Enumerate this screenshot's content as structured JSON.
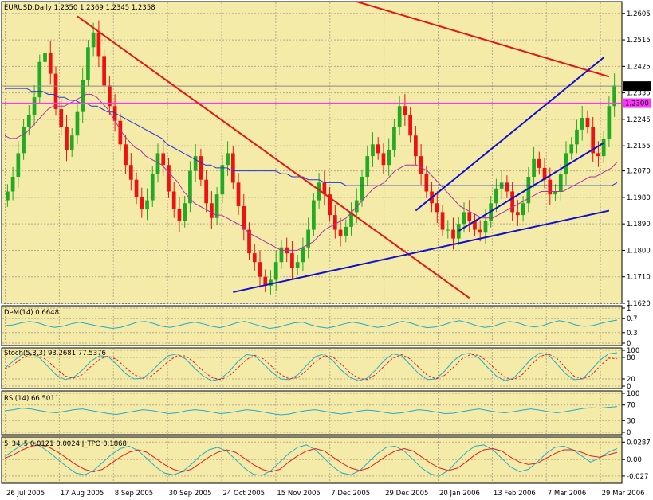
{
  "colors": {
    "background": "#F5EBA8",
    "grid": "#B5A98A",
    "bull": "#22AA22",
    "bear": "#EE1111",
    "trend_red": "#E01818",
    "trend_blue": "#1010CC",
    "ma_long": "#2233DD",
    "ma_short": "#AA33AA",
    "level_magenta": "#FF33FF",
    "indicator_teal": "#22AACC",
    "signal_red": "#DD2222"
  },
  "chart_data": [
    {
      "type": "candlestick",
      "title": "EURUSD,Daily  1.2350 1.2369 1.2345 1.2358",
      "ylim": [
        1.162,
        1.2645
      ],
      "yticks": [
        "1.2605",
        "1.2515",
        "1.2425",
        "1.2335",
        "1.2245",
        "1.2155",
        "1.2070",
        "1.1980",
        "1.1890",
        "1.1800",
        "1.1710",
        "1.1620"
      ],
      "price_label": "1.2358",
      "level_label": "1.2300",
      "xticks": [
        "26 Jul 2005",
        "17 Aug 2005",
        "8 Sep 2005",
        "30 Sep 2005",
        "24 Oct 2005",
        "15 Nov 2005",
        "7 Dec 2005",
        "29 Dec 2005",
        "20 Jan 2006",
        "13 Feb 2006",
        "7 Mar 2006",
        "29 Mar 2006"
      ],
      "close": [
        1.2,
        1.205,
        1.213,
        1.222,
        1.226,
        1.232,
        1.244,
        1.247,
        1.24,
        1.228,
        1.222,
        1.214,
        1.219,
        1.227,
        1.238,
        1.249,
        1.254,
        1.246,
        1.236,
        1.229,
        1.224,
        1.216,
        1.209,
        1.204,
        1.198,
        1.194,
        1.197,
        1.206,
        1.213,
        1.209,
        1.2,
        1.194,
        1.19,
        1.196,
        1.207,
        1.212,
        1.204,
        1.196,
        1.191,
        1.199,
        1.209,
        1.213,
        1.203,
        1.195,
        1.187,
        1.179,
        1.176,
        1.171,
        1.168,
        1.17,
        1.176,
        1.181,
        1.179,
        1.174,
        1.176,
        1.181,
        1.187,
        1.197,
        1.203,
        1.199,
        1.192,
        1.187,
        1.185,
        1.188,
        1.193,
        1.197,
        1.205,
        1.212,
        1.216,
        1.213,
        1.209,
        1.214,
        1.222,
        1.229,
        1.226,
        1.219,
        1.212,
        1.206,
        1.2,
        1.196,
        1.193,
        1.187,
        1.187,
        1.184,
        1.189,
        1.193,
        1.19,
        1.187,
        1.186,
        1.19,
        1.196,
        1.201,
        1.203,
        1.2,
        1.193,
        1.192,
        1.196,
        1.205,
        1.211,
        1.208,
        1.204,
        1.199,
        1.2,
        1.206,
        1.213,
        1.216,
        1.221,
        1.225,
        1.222,
        1.213,
        1.212,
        1.218,
        1.229,
        1.236
      ],
      "ma_long": [
        1.235,
        1.235,
        1.235,
        1.235,
        1.235,
        1.234,
        1.234,
        1.234,
        1.233,
        1.233,
        1.232,
        1.232,
        1.231,
        1.231,
        1.23,
        1.23,
        1.229,
        1.229,
        1.228,
        1.227,
        1.227,
        1.226,
        1.225,
        1.224,
        1.223,
        1.222,
        1.221,
        1.22,
        1.219,
        1.218,
        1.216,
        1.215,
        1.214,
        1.213,
        1.212,
        1.211,
        1.21,
        1.209,
        1.209,
        1.208,
        1.208,
        1.208,
        1.207,
        1.207,
        1.207,
        1.207,
        1.207,
        1.207,
        1.207,
        1.207,
        1.207,
        1.206,
        1.206,
        1.205,
        1.205,
        1.205,
        1.204,
        1.204,
        1.204,
        1.203,
        1.203,
        1.203,
        1.203,
        1.202,
        1.202,
        1.202,
        1.202,
        1.202,
        1.202,
        1.202,
        1.202,
        1.202,
        1.202,
        1.202,
        1.202,
        1.202,
        1.202,
        1.202,
        1.202,
        1.202,
        1.202,
        1.202,
        1.202,
        1.202,
        1.202,
        1.202,
        1.202,
        1.202,
        1.202,
        1.202,
        1.202,
        1.202,
        1.202,
        1.202,
        1.202,
        1.202,
        1.202,
        1.202,
        1.202,
        1.202,
        1.202,
        1.202,
        1.202,
        1.202,
        1.202,
        1.202,
        1.202,
        1.202,
        1.202,
        1.202,
        1.202,
        1.202,
        1.202,
        1.203
      ],
      "ma_short": [
        1.219,
        1.218,
        1.218,
        1.219,
        1.22,
        1.222,
        1.224,
        1.226,
        1.228,
        1.229,
        1.229,
        1.229,
        1.23,
        1.231,
        1.232,
        1.233,
        1.233,
        1.232,
        1.23,
        1.228,
        1.225,
        1.222,
        1.219,
        1.217,
        1.215,
        1.214,
        1.212,
        1.211,
        1.21,
        1.209,
        1.207,
        1.205,
        1.203,
        1.2,
        1.198,
        1.196,
        1.195,
        1.194,
        1.193,
        1.192,
        1.192,
        1.191,
        1.19,
        1.189,
        1.188,
        1.186,
        1.185,
        1.184,
        1.183,
        1.182,
        1.181,
        1.18,
        1.18,
        1.18,
        1.18,
        1.181,
        1.182,
        1.183,
        1.185,
        1.187,
        1.188,
        1.189,
        1.19,
        1.191,
        1.193,
        1.195,
        1.197,
        1.199,
        1.201,
        1.202,
        1.203,
        1.205,
        1.207,
        1.208,
        1.209,
        1.209,
        1.209,
        1.208,
        1.207,
        1.205,
        1.203,
        1.201,
        1.199,
        1.197,
        1.195,
        1.194,
        1.193,
        1.192,
        1.191,
        1.191,
        1.191,
        1.192,
        1.193,
        1.194,
        1.195,
        1.196,
        1.197,
        1.198,
        1.199,
        1.2,
        1.2,
        1.2,
        1.2,
        1.2,
        1.201,
        1.202,
        1.203,
        1.204,
        1.205,
        1.205,
        1.206,
        1.207,
        1.208,
        1.21
      ]
    },
    {
      "type": "line",
      "title": "DeM(14) 0.6648",
      "ylim": [
        0,
        1
      ],
      "yticks": [
        "1",
        "0.7",
        "0.3",
        "0"
      ],
      "series": [
        {
          "values": [
            0.5,
            0.52,
            0.58,
            0.62,
            0.58,
            0.5,
            0.45,
            0.48,
            0.55,
            0.6,
            0.55,
            0.5,
            0.46,
            0.42,
            0.45,
            0.52,
            0.6,
            0.62,
            0.56,
            0.48,
            0.45,
            0.5,
            0.56,
            0.6,
            0.55,
            0.48,
            0.44,
            0.5,
            0.58,
            0.62,
            0.55,
            0.48,
            0.42,
            0.45,
            0.52,
            0.58,
            0.6,
            0.52,
            0.46,
            0.43,
            0.48,
            0.55,
            0.6,
            0.56,
            0.5,
            0.45,
            0.48,
            0.55,
            0.62,
            0.58,
            0.5,
            0.44,
            0.46,
            0.52,
            0.6,
            0.64,
            0.58,
            0.5,
            0.45,
            0.48,
            0.56,
            0.62,
            0.58,
            0.5,
            0.46,
            0.5,
            0.58,
            0.64,
            0.6,
            0.52,
            0.48,
            0.5,
            0.56,
            0.62,
            0.66
          ]
        }
      ]
    },
    {
      "type": "line",
      "title": "Stoch(5,3,3) 93.2681 77.5376",
      "ylim": [
        0,
        100
      ],
      "yticks": [
        "100",
        "80",
        "20",
        "0"
      ],
      "series": [
        {
          "values": [
            50,
            70,
            88,
            92,
            80,
            55,
            30,
            18,
            25,
            45,
            70,
            85,
            82,
            60,
            35,
            20,
            22,
            40,
            65,
            85,
            90,
            75,
            50,
            28,
            15,
            20,
            40,
            68,
            88,
            85,
            62,
            38,
            20,
            18,
            32,
            58,
            82,
            90,
            72,
            45,
            25,
            15,
            22,
            45,
            72,
            90,
            85,
            60,
            35,
            18,
            20,
            42,
            70,
            88,
            92,
            78,
            52,
            28,
            15,
            22,
            48,
            75,
            92,
            88,
            62,
            35,
            18,
            20,
            45,
            72,
            90,
            93
          ]
        },
        {
          "values": [
            48,
            60,
            78,
            88,
            86,
            70,
            48,
            28,
            22,
            32,
            55,
            75,
            84,
            74,
            52,
            32,
            22,
            28,
            48,
            70,
            85,
            84,
            65,
            42,
            24,
            18,
            28,
            50,
            74,
            86,
            76,
            54,
            32,
            20,
            24,
            44,
            68,
            84,
            82,
            62,
            38,
            22,
            18,
            32,
            56,
            78,
            88,
            76,
            52,
            30,
            20,
            30,
            52,
            76,
            88,
            86,
            68,
            44,
            24,
            18,
            32,
            58,
            82,
            90,
            78,
            52,
            28,
            20,
            30,
            56,
            78,
            77
          ]
        }
      ]
    },
    {
      "type": "line",
      "title": "RSI(14) 66.5011",
      "ylim": [
        0,
        100
      ],
      "yticks": [
        "100",
        "70",
        "30",
        "0"
      ],
      "series": [
        {
          "values": [
            55,
            58,
            62,
            60,
            56,
            52,
            50,
            54,
            58,
            60,
            56,
            52,
            48,
            46,
            50,
            54,
            58,
            56,
            52,
            48,
            50,
            55,
            58,
            56,
            52,
            48,
            50,
            54,
            58,
            56,
            52,
            48,
            45,
            47,
            52,
            56,
            58,
            54,
            50,
            47,
            50,
            54,
            57,
            55,
            51,
            48,
            50,
            54,
            58,
            56,
            52,
            48,
            49,
            53,
            57,
            60,
            56,
            52,
            50,
            53,
            57,
            60,
            57,
            53,
            50,
            53,
            57,
            61,
            63,
            62,
            64,
            66
          ]
        }
      ]
    },
    {
      "type": "line",
      "title": "5_34_5 0.0121 0.0024 J_TPO 0.1868",
      "ylim": [
        -0.035,
        0.033
      ],
      "yticks": [
        "0.0287",
        "0.00",
        "-0.027"
      ],
      "series": [
        {
          "values": [
            0.005,
            0.015,
            0.025,
            0.028,
            0.022,
            0.012,
            0.0,
            -0.012,
            -0.022,
            -0.025,
            -0.018,
            -0.005,
            0.008,
            0.018,
            0.022,
            0.015,
            0.002,
            -0.012,
            -0.022,
            -0.025,
            -0.02,
            -0.008,
            0.006,
            0.016,
            0.02,
            0.014,
            0.0,
            -0.014,
            -0.024,
            -0.026,
            -0.018,
            -0.004,
            0.01,
            0.02,
            0.024,
            0.016,
            0.002,
            -0.012,
            -0.022,
            -0.025,
            -0.018,
            -0.004,
            0.01,
            0.02,
            0.022,
            0.014,
            0.0,
            -0.014,
            -0.024,
            -0.026,
            -0.018,
            -0.002,
            0.012,
            0.022,
            0.024,
            0.016,
            0.002,
            -0.012,
            -0.02,
            -0.016,
            -0.004,
            0.01,
            0.02,
            0.022,
            0.016,
            0.006,
            -0.004,
            0.002,
            0.012,
            0.018
          ]
        },
        {
          "values": [
            0.002,
            0.008,
            0.016,
            0.022,
            0.024,
            0.02,
            0.012,
            0.002,
            -0.008,
            -0.016,
            -0.02,
            -0.016,
            -0.006,
            0.004,
            0.012,
            0.016,
            0.012,
            0.002,
            -0.008,
            -0.016,
            -0.02,
            -0.016,
            -0.006,
            0.004,
            0.012,
            0.016,
            0.012,
            0.002,
            -0.008,
            -0.016,
            -0.02,
            -0.016,
            -0.004,
            0.006,
            0.014,
            0.018,
            0.014,
            0.004,
            -0.006,
            -0.014,
            -0.018,
            -0.014,
            -0.004,
            0.006,
            0.014,
            0.018,
            0.014,
            0.004,
            -0.006,
            -0.014,
            -0.018,
            -0.014,
            -0.004,
            0.008,
            0.016,
            0.018,
            0.014,
            0.004,
            -0.004,
            -0.008,
            -0.006,
            0.002,
            0.01,
            0.016,
            0.016,
            0.012,
            0.006,
            0.004,
            0.008,
            0.012
          ]
        }
      ]
    }
  ]
}
